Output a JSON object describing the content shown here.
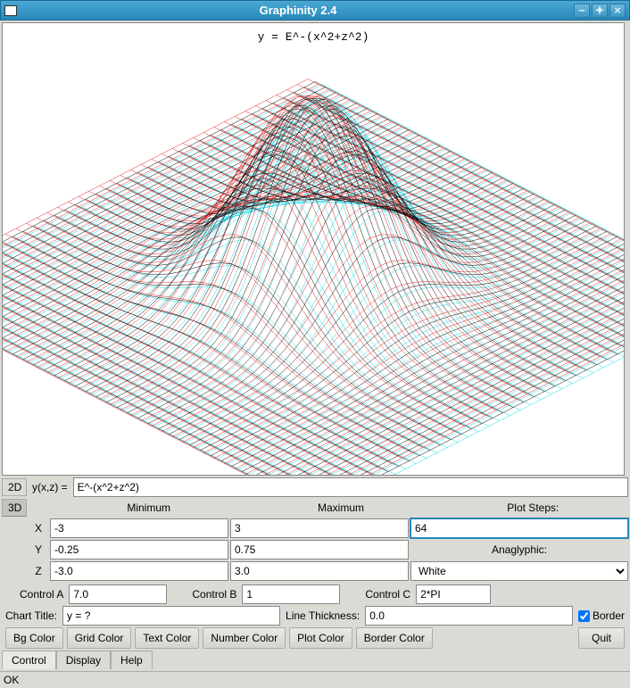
{
  "window": {
    "title": "Graphinity 2.4"
  },
  "chart_data": {
    "type": "surface3d",
    "title": "y = E^-(x^2+z^2)",
    "function": "E^-(x^2+z^2)",
    "x_range": [
      -3,
      3
    ],
    "y_range": [
      -0.25,
      0.75
    ],
    "z_range": [
      -3.0,
      3.0
    ],
    "plot_steps": 64,
    "anaglyphic": "White",
    "rendering": "wireframe-anaglyph"
  },
  "form": {
    "tab_2d": "2D",
    "tab_3d": "3D",
    "yxz_label": "y(x,z) =",
    "function_value": "E^-(x^2+z^2)",
    "headers": {
      "min": "Minimum",
      "max": "Maximum",
      "steps": "Plot Steps:"
    },
    "x_label": "X",
    "x_min": "-3",
    "x_max": "3",
    "plot_steps": "64",
    "y_label": "Y",
    "y_min": "-0.25",
    "y_max": "0.75",
    "anaglyphic_label": "Anaglyphic:",
    "z_label": "Z",
    "z_min": "-3.0",
    "z_max": "3.0",
    "anaglyphic_value": "White",
    "control_a_label": "Control A",
    "control_a_value": "7.0",
    "control_b_label": "Control B",
    "control_b_value": "1",
    "control_c_label": "Control C",
    "control_c_value": "2*PI",
    "chart_title_label": "Chart Title:",
    "chart_title_value": "y = ?",
    "line_thickness_label": "Line Thickness:",
    "line_thickness_value": "0.0",
    "border_label": "Border",
    "border_checked": true,
    "buttons": {
      "bg": "Bg Color",
      "grid": "Grid Color",
      "text": "Text Color",
      "number": "Number Color",
      "plot": "Plot Color",
      "border": "Border Color",
      "quit": "Quit"
    },
    "tabs": {
      "control": "Control",
      "display": "Display",
      "help": "Help"
    }
  },
  "status": "OK"
}
